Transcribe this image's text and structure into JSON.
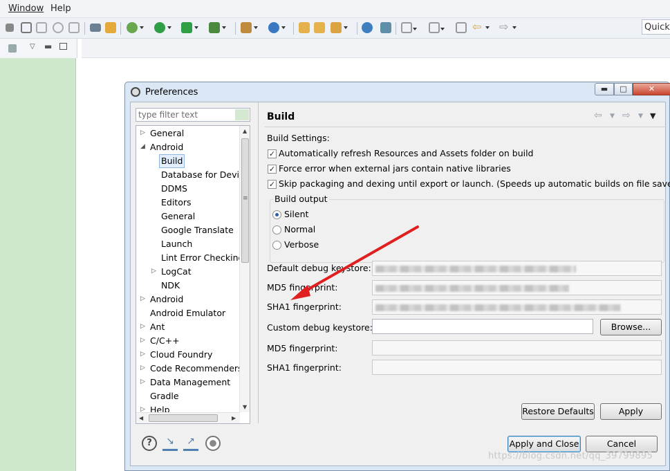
{
  "menubar": {
    "window": "Window",
    "help": "Help"
  },
  "toolbar": {
    "quick_access": "Quick"
  },
  "dialog": {
    "title": "Preferences",
    "filter_placeholder": "type filter text",
    "tree": [
      {
        "label": "General",
        "level": 0,
        "twisty": "collapsed"
      },
      {
        "label": "Android",
        "level": 0,
        "twisty": "expanded"
      },
      {
        "label": "Build",
        "level": 1,
        "selected": true
      },
      {
        "label": "Database for Devic",
        "level": 1
      },
      {
        "label": "DDMS",
        "level": 1
      },
      {
        "label": "Editors",
        "level": 1
      },
      {
        "label": "General",
        "level": 1
      },
      {
        "label": "Google Translate",
        "level": 1
      },
      {
        "label": "Launch",
        "level": 1
      },
      {
        "label": "Lint Error Checking",
        "level": 1
      },
      {
        "label": "LogCat",
        "level": 1,
        "twisty": "collapsed"
      },
      {
        "label": "NDK",
        "level": 1
      },
      {
        "label": "Android",
        "level": 0,
        "twisty": "collapsed"
      },
      {
        "label": "Android Emulator",
        "level": 0
      },
      {
        "label": "Ant",
        "level": 0,
        "twisty": "collapsed"
      },
      {
        "label": "C/C++",
        "level": 0,
        "twisty": "collapsed"
      },
      {
        "label": "Cloud Foundry",
        "level": 0,
        "twisty": "collapsed"
      },
      {
        "label": "Code Recommenders",
        "level": 0,
        "twisty": "collapsed"
      },
      {
        "label": "Data Management",
        "level": 0,
        "twisty": "collapsed"
      },
      {
        "label": "Gradle",
        "level": 0
      },
      {
        "label": "Help",
        "level": 0,
        "twisty": "collapsed"
      }
    ],
    "page": {
      "title": "Build",
      "settings_label": "Build Settings:",
      "checkboxes": [
        {
          "label": "Automatically refresh Resources and Assets folder on build",
          "checked": true
        },
        {
          "label": "Force error when external jars contain native libraries",
          "checked": true
        },
        {
          "label": "Skip packaging and dexing until export or launch. (Speeds up automatic builds on file save)",
          "checked": true
        }
      ],
      "output_group": "Build output",
      "output_options": [
        {
          "label": "Silent",
          "selected": true
        },
        {
          "label": "Normal",
          "selected": false
        },
        {
          "label": "Verbose",
          "selected": false
        }
      ],
      "default_keystore_label": "Default debug keystore:",
      "md5_label": "MD5 fingerprint:",
      "sha1_label": "SHA1 fingerprint:",
      "custom_keystore_label": "Custom debug keystore:",
      "custom_keystore_value": "",
      "browse_button": "Browse...",
      "restore_defaults_button": "Restore Defaults",
      "apply_button": "Apply"
    },
    "apply_close_button": "Apply and Close",
    "cancel_button": "Cancel"
  },
  "watermark": "https://blog.csdn.net/qq_39799895",
  "colors": {
    "explorer_bg": "#cde8cd",
    "dialog_frame": "#dbe7f5",
    "annotation_arrow": "#e02020"
  }
}
